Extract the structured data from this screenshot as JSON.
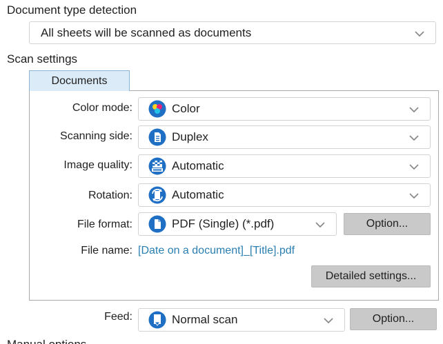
{
  "document_type": {
    "heading": "Document type detection",
    "value": "All sheets will be scanned as documents"
  },
  "scan_settings": {
    "heading": "Scan settings",
    "tab_label": "Documents",
    "color_mode": {
      "label": "Color mode:",
      "value": "Color",
      "icon": "color-palette-icon"
    },
    "scanning_side": {
      "label": "Scanning side:",
      "value": "Duplex",
      "icon": "duplex-page-icon"
    },
    "image_quality": {
      "label": "Image quality:",
      "value": "Automatic",
      "icon": "auto-quality-icon"
    },
    "rotation": {
      "label": "Rotation:",
      "value": "Automatic",
      "icon": "rotation-icon"
    },
    "file_format": {
      "label": "File format:",
      "value": "PDF (Single) (*.pdf)",
      "icon": "document-icon",
      "option_label": "Option..."
    },
    "file_name": {
      "label": "File name:",
      "value": "[Date on a document]_[Title].pdf"
    },
    "detailed_settings_label": "Detailed settings..."
  },
  "feed": {
    "label": "Feed:",
    "value": "Normal scan",
    "icon": "feed-icon",
    "option_label": "Option..."
  },
  "next_section_heading_partial": "Manual  options",
  "colors": {
    "icon_blue": "#1f6fc4",
    "link": "#2a7fb0",
    "tab_bg": "#dcebf8",
    "button_bg": "#c9c9c9"
  }
}
